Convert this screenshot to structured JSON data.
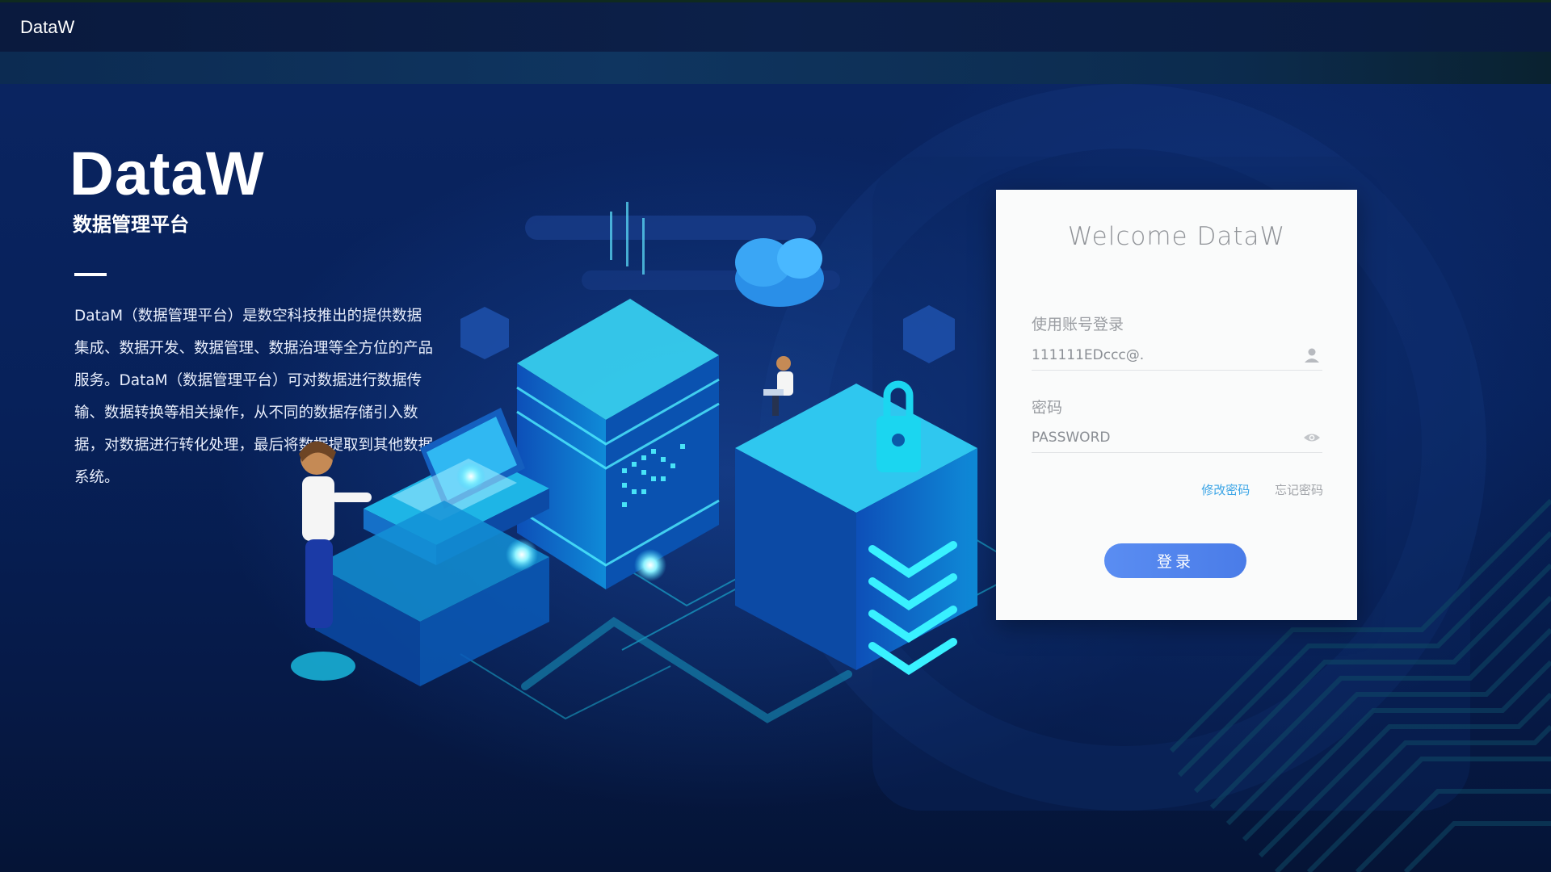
{
  "header": {
    "brand": "DataW"
  },
  "hero": {
    "title": "DataW",
    "subtitle": "数据管理平台",
    "description": "DataM（数据管理平台）是数空科技推出的提供数据集成、数据开发、数据管理、数据治理等全方位的产品服务。DataM（数据管理平台）可对数据进行数据传输、数据转换等相关操作，从不同的数据存储引入数据，对数据进行转化处理，最后将数据提取到其他数据系统。"
  },
  "login": {
    "welcome": "Welcome DataW",
    "account_label": "使用账号登录",
    "account_value": "111111EDccc@.",
    "account_icon": "user-icon",
    "password_label": "密码",
    "password_value": "PASSWORD",
    "password_icon": "eye-icon",
    "change_password": "修改密码",
    "forgot_password": "忘记密码",
    "submit_label": "登录"
  },
  "colors": {
    "accent": "#4e82ee",
    "link": "#3aa4e6",
    "background": "#071a45"
  }
}
